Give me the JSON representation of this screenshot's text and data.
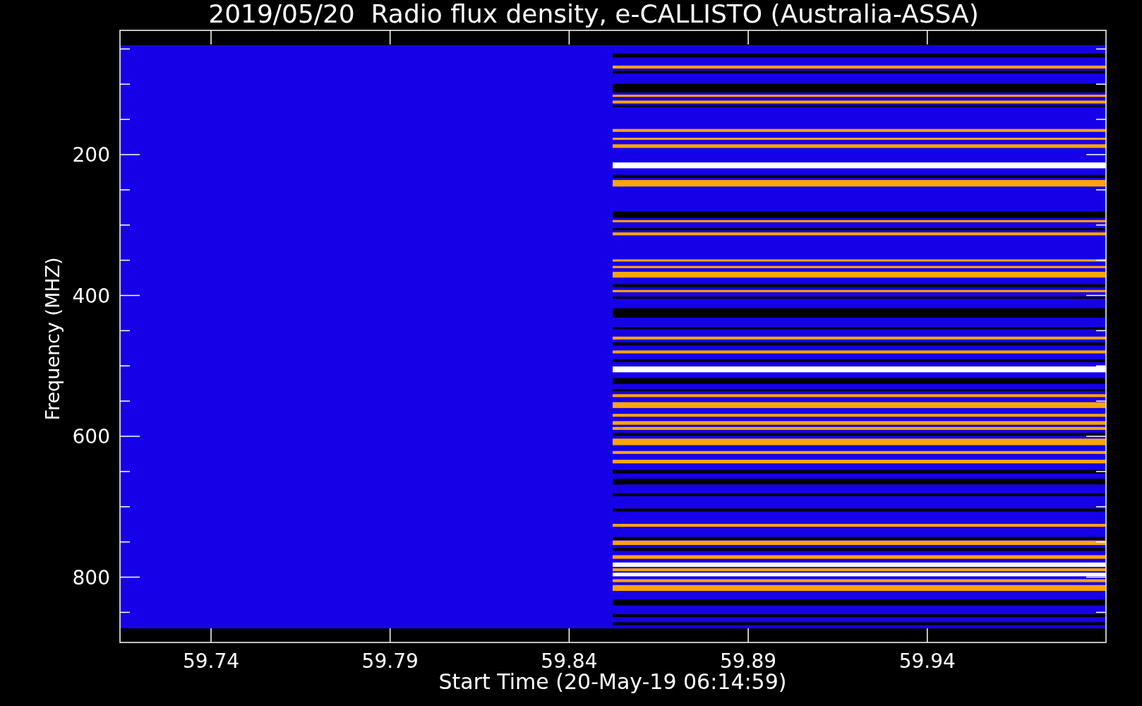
{
  "chart": {
    "title": "2019/05/20  Radio flux density, e-CALLISTO (Australia-ASSA)",
    "ylabel": "Frequency (MHZ)",
    "xlabel": "Start Time (20-May-19 06:14:59)",
    "yticks": [
      "200",
      "400",
      "600",
      "800"
    ],
    "xticks": [
      "59.74",
      "59.79",
      "59.84",
      "59.89",
      "59.94"
    ]
  }
}
